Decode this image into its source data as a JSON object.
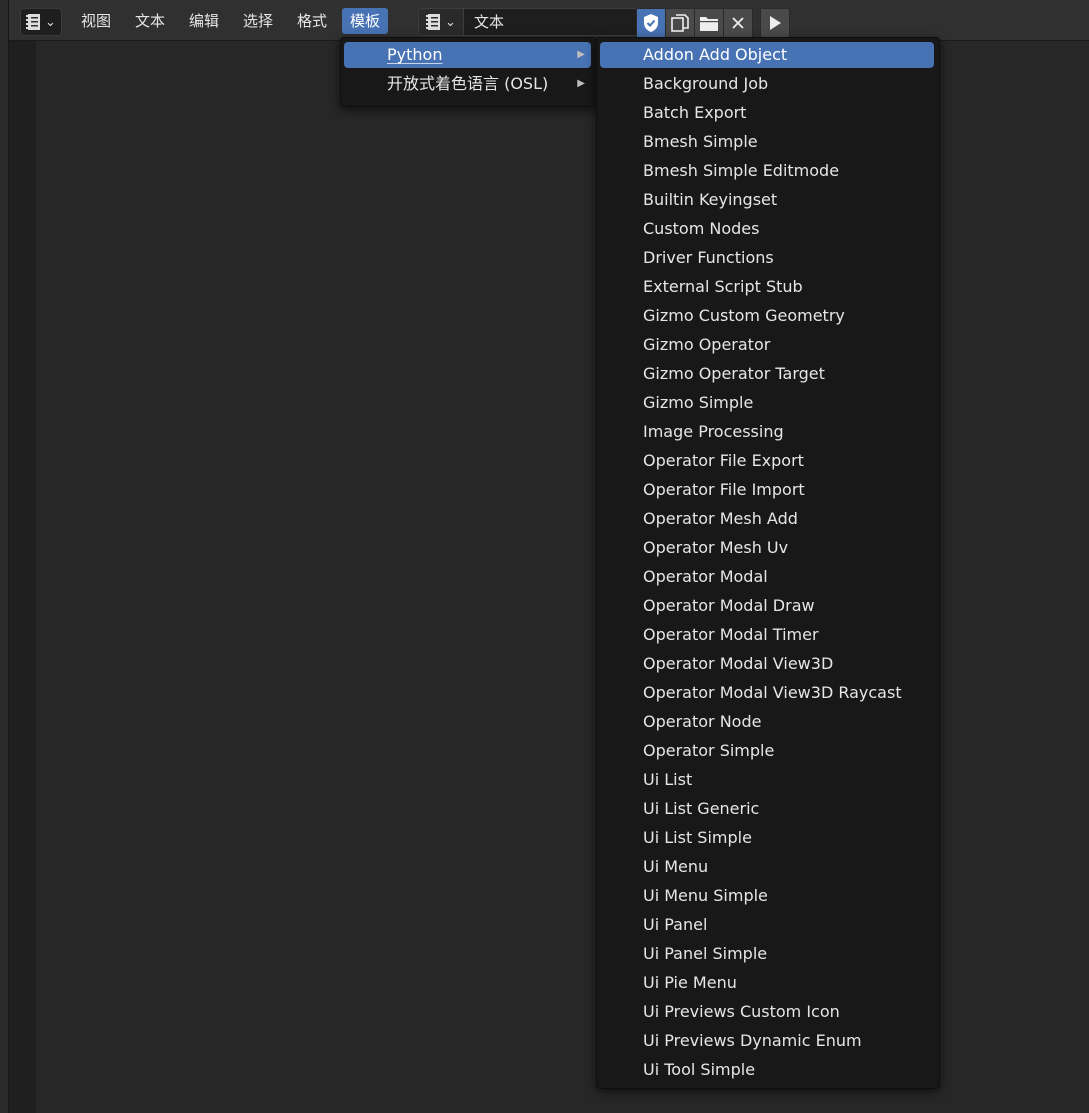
{
  "header": {
    "menus": [
      "视图",
      "文本",
      "编辑",
      "选择",
      "格式",
      "模板"
    ],
    "text_name": "文本",
    "editor_icon": "text-editor-icon",
    "text_icon": "text-datablock-icon",
    "buttons": [
      "fake-user-shield-icon",
      "new-text-icon",
      "open-folder-icon",
      "close-icon",
      "run-script-icon"
    ]
  },
  "templates_menu": {
    "items": [
      {
        "label": "Python",
        "underline": "P"
      },
      {
        "label": "开放式着色语言 (OSL)",
        "underline": ""
      }
    ]
  },
  "python_submenu": {
    "items": [
      "Addon Add Object",
      "Background Job",
      "Batch Export",
      "Bmesh Simple",
      "Bmesh Simple Editmode",
      "Builtin Keyingset",
      "Custom Nodes",
      "Driver Functions",
      "External Script Stub",
      "Gizmo Custom Geometry",
      "Gizmo Operator",
      "Gizmo Operator Target",
      "Gizmo Simple",
      "Image Processing",
      "Operator File Export",
      "Operator File Import",
      "Operator Mesh Add",
      "Operator Mesh Uv",
      "Operator Modal",
      "Operator Modal Draw",
      "Operator Modal Timer",
      "Operator Modal View3D",
      "Operator Modal View3D Raycast",
      "Operator Node",
      "Operator Simple",
      "Ui List",
      "Ui List Generic",
      "Ui List Simple",
      "Ui Menu",
      "Ui Menu Simple",
      "Ui Panel",
      "Ui Panel Simple",
      "Ui Pie Menu",
      "Ui Previews Custom Icon",
      "Ui Previews Dynamic Enum",
      "Ui Tool Simple"
    ],
    "highlighted": "Addon Add Object"
  },
  "colors": {
    "accent": "#4772b3",
    "menu_bg": "#181818",
    "editor_bg": "#272727"
  }
}
